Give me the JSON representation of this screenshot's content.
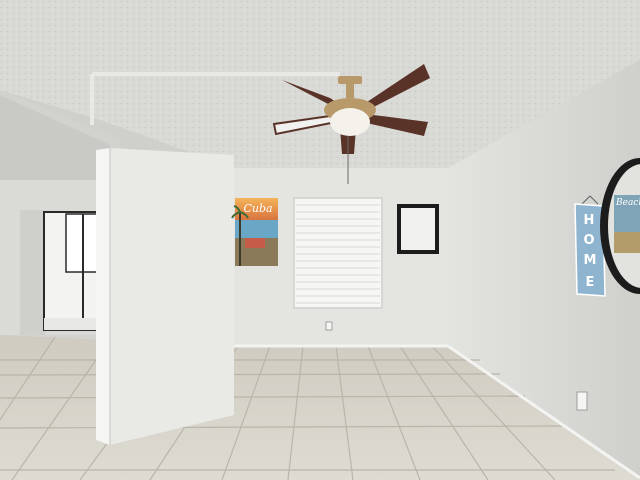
{
  "scene": {
    "subject": "empty room with ceiling fan",
    "colors": {
      "ceiling": "#d9d9d5",
      "back_wall": "#e4e4e0",
      "right_wall": "#dcddd9",
      "left_wall": "#d2d3cf",
      "door": "#e9e9e6",
      "floor": "#d8d5cc",
      "floor_grout": "#b9b5aa",
      "fan_blade": "#5a3328",
      "fan_body": "#b89a6a",
      "mirror_frame": "#1c1c1c",
      "home_sign": "#8fb4cf"
    }
  },
  "poster": {
    "title": "Cuba"
  },
  "home_sign": {
    "letters": [
      "H",
      "O",
      "M",
      "E"
    ]
  },
  "round_mirror": {
    "reflected_text": "Beach"
  }
}
